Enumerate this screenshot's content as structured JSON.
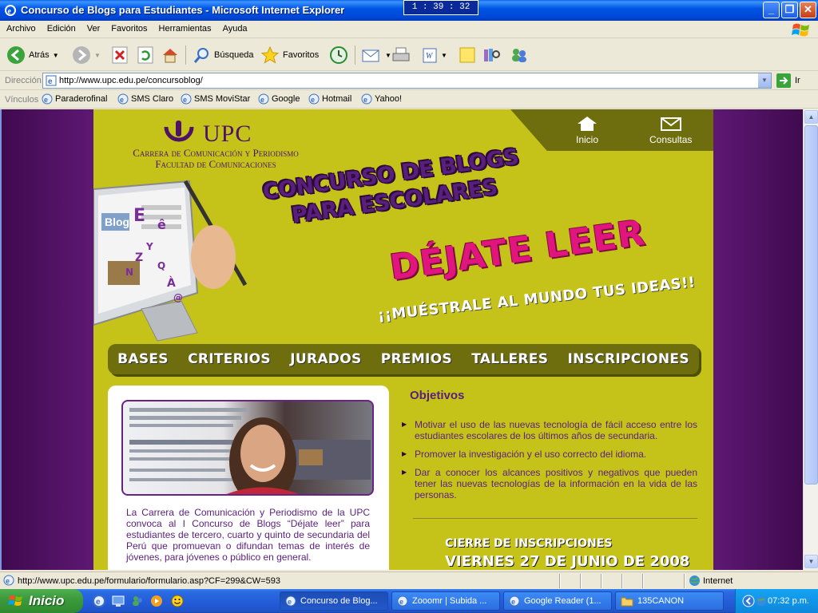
{
  "window": {
    "title": "Concurso de Blogs para Estudiantes - Microsoft Internet Explorer",
    "clock": "1 : 39 : 32",
    "min": "_",
    "max": "❐",
    "close": "✕"
  },
  "menu": [
    "Archivo",
    "Edición",
    "Ver",
    "Favoritos",
    "Herramientas",
    "Ayuda"
  ],
  "toolbar": {
    "back_label": "Atrás",
    "search_label": "Búsqueda",
    "favorites_label": "Favoritos"
  },
  "address": {
    "label": "Dirección",
    "url": "http://www.upc.edu.pe/concursoblog/",
    "go_label": "Ir"
  },
  "links": {
    "label": "Vínculos",
    "items": [
      "Paraderofinal",
      "SMS Claro",
      "SMS MoviStar",
      "Google",
      "Hotmail",
      "Yahoo!"
    ]
  },
  "page": {
    "brand": "UPC",
    "career_line1": "Carrera de Comunicación y Periodismo",
    "career_line2": "Facultad de Comunicaciones",
    "nav_home": "Inicio",
    "nav_contact": "Consultas",
    "headline_line1": "CONCURSO DE BLOGS",
    "headline_line2": "PARA ESCOLARES",
    "headline_main": "DÉJATE LEER",
    "headline_sub": "¡¡MUÉSTRALE AL MUNDO TUS IDEAS!!",
    "menu_items": [
      "BASES",
      "CRITERIOS",
      "JURADOS",
      "PREMIOS",
      "TALLERES",
      "INSCRIPCIONES"
    ],
    "intro_text": "La Carrera de Comunicación y Periodismo de la UPC convoca al I Concurso de Blogs “Déjate leer” para estudiantes de tercero, cuarto y quinto de secundaria del Perú que promuevan o difundan temas de interés de jóvenes, para jóvenes o público en general.",
    "objectives_title": "Objetivos",
    "objectives": [
      "Motivar el uso de las nuevas tecnología de fácil acceso entre los estudiantes escolares de los últimos años de secundaria.",
      "Promover la investigación y el uso correcto del idioma.",
      "Dar a conocer los alcances positivos y negativos que pueden tener las nuevas tecnologías de la información en la vida de las personas."
    ],
    "deadline_label": "CIERRE DE INSCRIPCIONES",
    "deadline_date": "VIERNES 27 DE JUNIO DE 2008"
  },
  "status": {
    "url": "http://www.upc.edu.pe/formulario/formulario.asp?CF=299&CW=593",
    "zone": "Internet"
  },
  "taskbar": {
    "start_label": "Inicio",
    "tasks": [
      "Concurso de Blog...",
      "Zooomr | Subida ...",
      "Google Reader (1...",
      "135CANON"
    ],
    "time": "07:32 p.m."
  },
  "colors": {
    "page_bg": "#C5C319",
    "side_purple": "#5B156E",
    "nav_olive": "#6E6E0E",
    "brand_purple": "#5A1E7D",
    "headline_pink": "#E0157E"
  }
}
